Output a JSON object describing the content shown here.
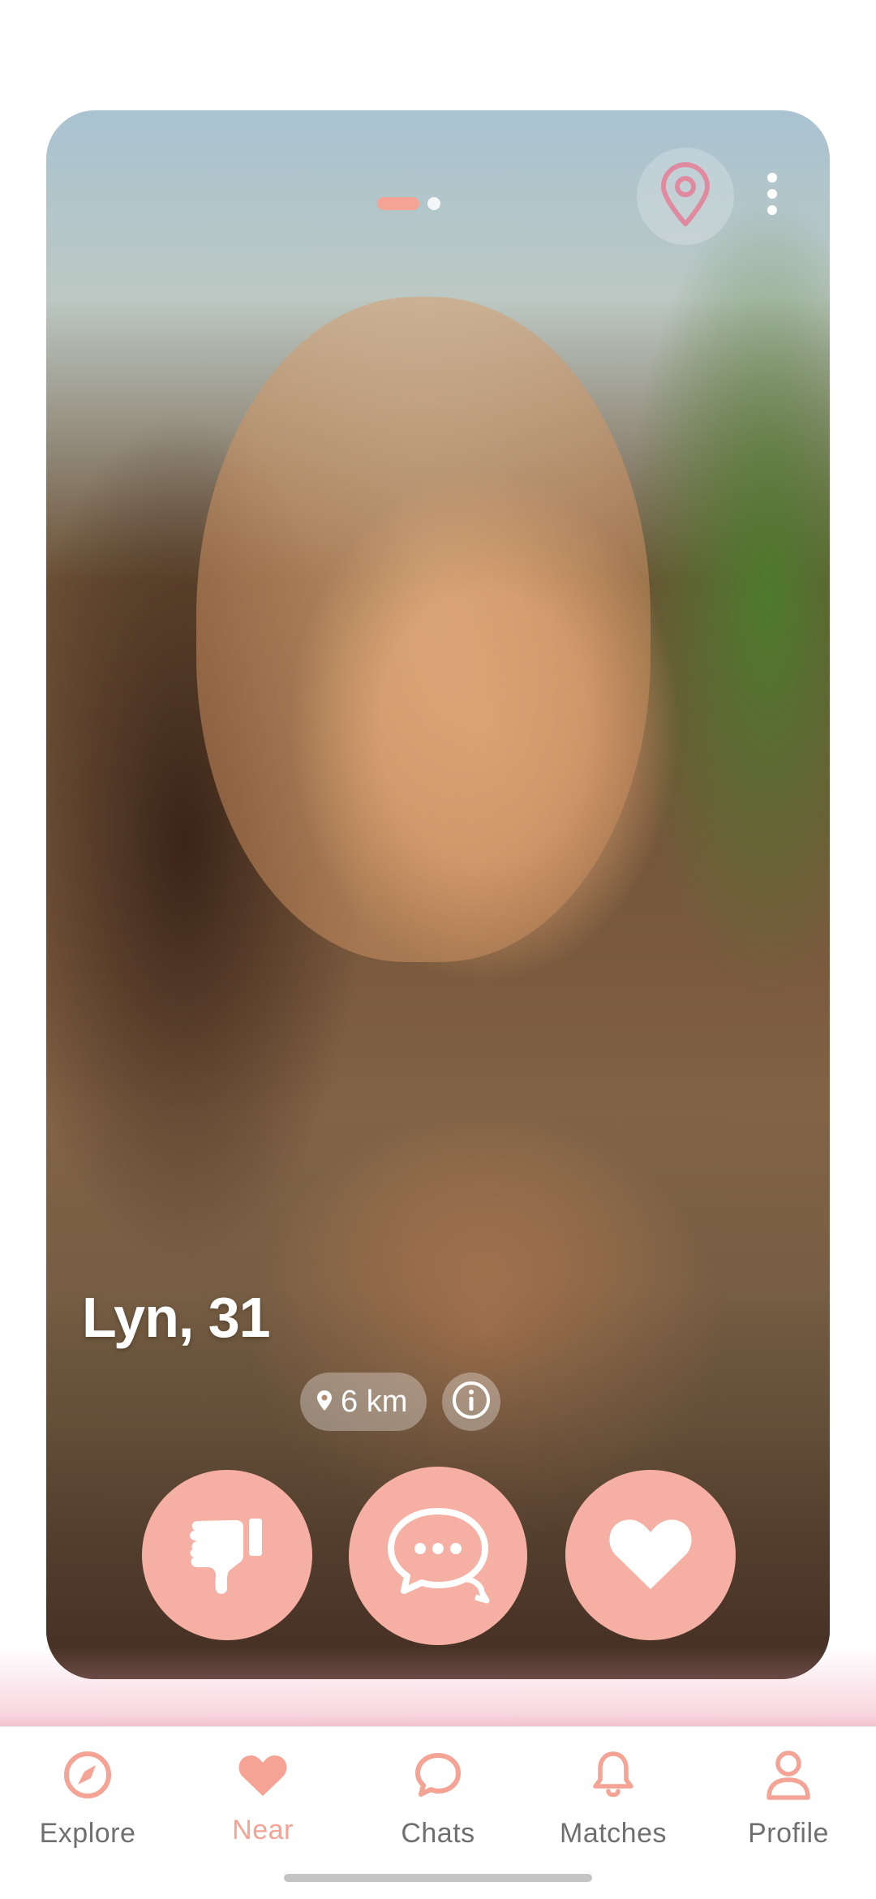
{
  "card": {
    "name_age": "Lyn, 31",
    "distance": "6 km",
    "photo_count": 2,
    "current_photo": 1
  },
  "actions": [
    {
      "name": "dislike",
      "icon": "thumbs-down-icon"
    },
    {
      "name": "chat",
      "icon": "chat-bubbles-icon"
    },
    {
      "name": "like",
      "icon": "heart-icon"
    }
  ],
  "nav": {
    "items": [
      {
        "label": "Explore",
        "icon": "compass-icon"
      },
      {
        "label": "Near",
        "icon": "heart-icon",
        "active": true
      },
      {
        "label": "Chats",
        "icon": "chat-bubble-icon"
      },
      {
        "label": "Matches",
        "icon": "bell-icon"
      },
      {
        "label": "Profile",
        "icon": "user-icon"
      }
    ]
  },
  "colors": {
    "accent": "#f4a394",
    "button": "#f6b0a3",
    "nav_inactive": "#6f6f6f"
  }
}
